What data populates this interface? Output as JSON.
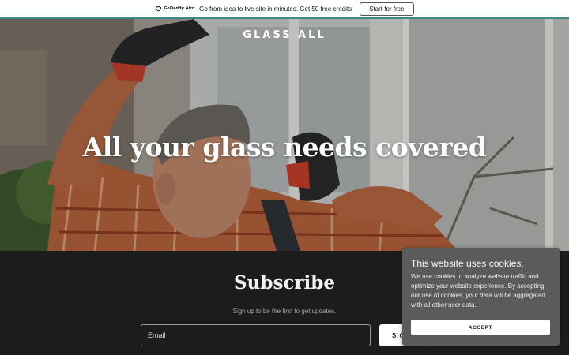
{
  "promo": {
    "logo_text": "GoDaddy Airo",
    "message": "Go from idea to live site in minutes. Get 50 free credits",
    "button_label": "Start for free"
  },
  "colors": {
    "accent_line": "#3b8a8a",
    "footer_bg": "#1c1c1c",
    "cookie_bg": "#5b5b5b"
  },
  "hero": {
    "brand": "GLASS ALL",
    "headline": "All your glass needs covered"
  },
  "subscribe": {
    "title": "Subscribe",
    "note": "Sign up to be the first to get updates.",
    "email_placeholder": "Email",
    "button_label": "SIG"
  },
  "cookie": {
    "title": "This website uses cookies.",
    "body": "We use cookies to analyze website traffic and optimize your website experience. By accepting our use of cookies, your data will be aggregated with all other user data.",
    "accept_label": "ACCEPT"
  }
}
